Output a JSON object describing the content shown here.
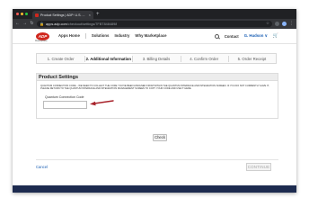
{
  "browser": {
    "tab_title": "Product Settings | ADP: U.S. ...",
    "tab_close": "×",
    "new_tab": "+",
    "url_host": "apps.adp.com",
    "url_path": "/checkout/settings/7FBT8484898",
    "traffic_colors": [
      "#ff5f57",
      "#febc2e",
      "#28c840"
    ]
  },
  "site": {
    "logo_text": "ADP",
    "logo_sub": "Marketplace",
    "nav": [
      "Apps Home",
      "Solutions",
      "Industry",
      "Why Marketplace"
    ],
    "contact": "Contact",
    "user": "G. Hudson ∨",
    "brand_color": "#d0271d"
  },
  "steps": [
    {
      "label": "1. Create Order",
      "active": false
    },
    {
      "label": "2. Additional Information",
      "active": true
    },
    {
      "label": "3. Billing Details",
      "active": false
    },
    {
      "label": "4. Confirm Order",
      "active": false
    },
    {
      "label": "5. Order Receipt",
      "active": false
    }
  ],
  "product_settings": {
    "title": "Product Settings",
    "notice": "QUANTUM CONNECTION CODE – WE NEED TO COLLECT THE CODE YOU'VE BEEN ASSIGNED FROM WITHIN THE QUANTUM INTERFACE AND INTEGRATION SCREEN. IF YOU DO NOT CURRENTLY HAVE IT, PLEASE RETURN TO THE QUANTUM INTERFACE AND INTEGRATION MANAGEMENT SCREEN TO COPY YOUR CODE AND USE IT HERE.",
    "field_label": "Quantum Connection Code",
    "field_value": "",
    "arrow_color": "#a8222a"
  },
  "actions": {
    "check": "Check",
    "cancel": "Cancel",
    "continue": "CONTINUE"
  },
  "footer_color": "#1d2b4f"
}
